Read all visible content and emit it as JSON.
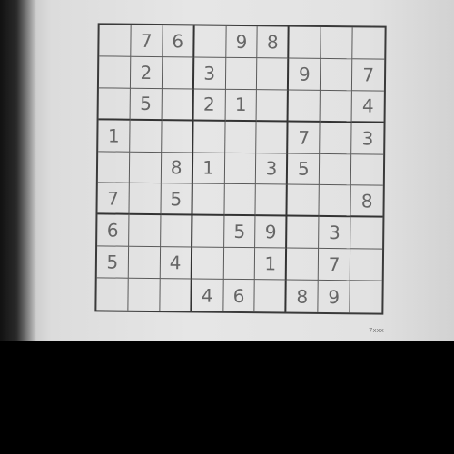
{
  "puzzle": {
    "grid": [
      [
        "",
        "7",
        "6",
        "",
        "9",
        "8",
        "",
        "",
        ""
      ],
      [
        "",
        "2",
        "",
        "3",
        "",
        "",
        "9",
        "",
        "7"
      ],
      [
        "",
        "5",
        "",
        "2",
        "1",
        "",
        "",
        "",
        "4"
      ],
      [
        "1",
        "",
        "",
        "",
        "",
        "",
        "7",
        "",
        "3"
      ],
      [
        "",
        "",
        "8",
        "1",
        "",
        "3",
        "5",
        "",
        ""
      ],
      [
        "7",
        "",
        "5",
        "",
        "",
        "",
        "",
        "",
        "8"
      ],
      [
        "6",
        "",
        "",
        "",
        "5",
        "9",
        "",
        "3",
        ""
      ],
      [
        "5",
        "",
        "4",
        "",
        "",
        "1",
        "",
        "7",
        ""
      ],
      [
        "",
        "",
        "",
        "4",
        "6",
        "",
        "8",
        "9",
        ""
      ]
    ]
  },
  "footer": {
    "mark": "7xxx"
  }
}
